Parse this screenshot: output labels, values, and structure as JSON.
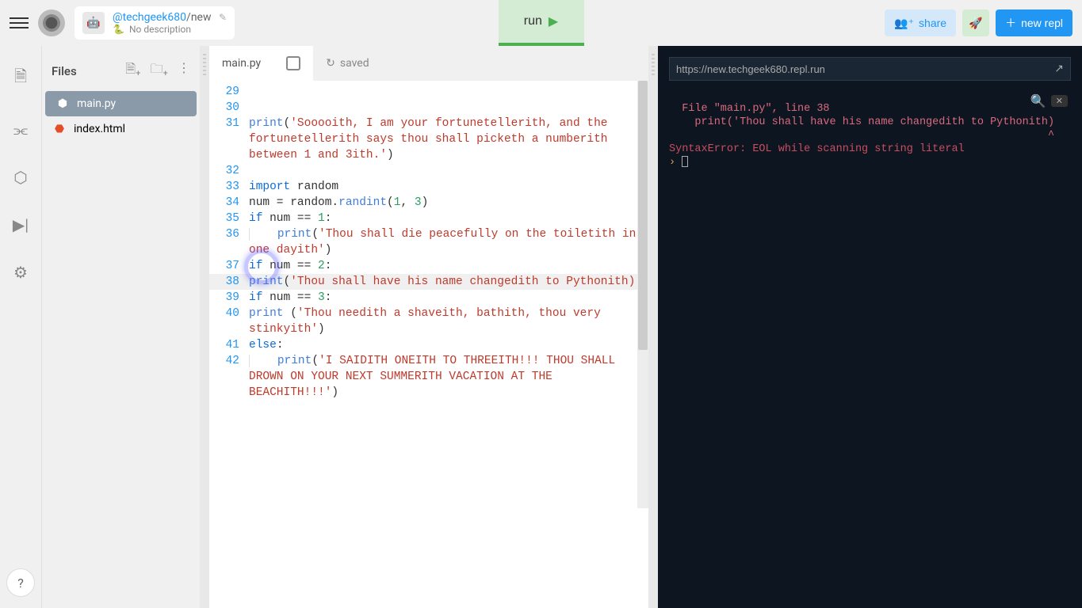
{
  "header": {
    "username": "@techgeek680",
    "separator": "/",
    "repl_name": "new",
    "description": "No description",
    "run_label": "run",
    "share_label": "share",
    "new_repl_label": "new repl"
  },
  "leftbar": {
    "icons": [
      "file",
      "share",
      "cube",
      "play-console",
      "gear"
    ]
  },
  "files": {
    "title": "Files",
    "items": [
      {
        "name": "main.py",
        "type": "python",
        "active": true
      },
      {
        "name": "index.html",
        "type": "html",
        "active": false
      }
    ]
  },
  "editor": {
    "tab_name": "main.py",
    "saved_label": "saved",
    "lines": [
      {
        "n": 29,
        "segs": []
      },
      {
        "n": 30,
        "segs": []
      },
      {
        "n": 31,
        "segs": [
          {
            "t": "print",
            "c": "fn"
          },
          {
            "t": "(",
            "c": "op"
          },
          {
            "t": "'Sooooith, I am your fortunetellerith, and the fortunetellerith says thou shall picketh a numberith between 1 and 3ith.'",
            "c": "str"
          },
          {
            "t": ")",
            "c": "op"
          }
        ]
      },
      {
        "n": 32,
        "segs": []
      },
      {
        "n": 33,
        "segs": [
          {
            "t": "import",
            "c": "kw"
          },
          {
            "t": " random",
            "c": "op"
          }
        ]
      },
      {
        "n": 34,
        "segs": [
          {
            "t": "num = random.",
            "c": "op"
          },
          {
            "t": "randint",
            "c": "fn"
          },
          {
            "t": "(",
            "c": "op"
          },
          {
            "t": "1",
            "c": "num"
          },
          {
            "t": ", ",
            "c": "op"
          },
          {
            "t": "3",
            "c": "num"
          },
          {
            "t": ")",
            "c": "op"
          }
        ]
      },
      {
        "n": 35,
        "segs": [
          {
            "t": "if",
            "c": "kw"
          },
          {
            "t": " num == ",
            "c": "op"
          },
          {
            "t": "1",
            "c": "num"
          },
          {
            "t": ":",
            "c": "op"
          }
        ]
      },
      {
        "n": 36,
        "indent": 1,
        "segs": [
          {
            "t": "print",
            "c": "fn"
          },
          {
            "t": "(",
            "c": "op"
          },
          {
            "t": "'Thou shall die peacefully on the toiletith in one dayith'",
            "c": "str"
          },
          {
            "t": ")",
            "c": "op"
          }
        ]
      },
      {
        "n": 37,
        "segs": [
          {
            "t": "if",
            "c": "kw"
          },
          {
            "t": " num == ",
            "c": "op"
          },
          {
            "t": "2",
            "c": "num"
          },
          {
            "t": ":",
            "c": "op"
          }
        ]
      },
      {
        "n": 38,
        "highlight": true,
        "segs": [
          {
            "t": "print",
            "c": "fn"
          },
          {
            "t": "(",
            "c": "op"
          },
          {
            "t": "'Thou shall have his name changedith to Pythonith)",
            "c": "str"
          }
        ]
      },
      {
        "n": 39,
        "segs": [
          {
            "t": "if",
            "c": "kw"
          },
          {
            "t": " num == ",
            "c": "op"
          },
          {
            "t": "3",
            "c": "num"
          },
          {
            "t": ":",
            "c": "op"
          }
        ]
      },
      {
        "n": 40,
        "segs": [
          {
            "t": "print ",
            "c": "fn"
          },
          {
            "t": "(",
            "c": "op"
          },
          {
            "t": "'Thou needith a shaveith, bathith, thou very stinkyith'",
            "c": "str"
          },
          {
            "t": ")",
            "c": "op"
          }
        ]
      },
      {
        "n": 41,
        "segs": [
          {
            "t": "else",
            "c": "kw"
          },
          {
            "t": ":",
            "c": "op"
          }
        ]
      },
      {
        "n": 42,
        "indent": 1,
        "segs": [
          {
            "t": "print",
            "c": "fn"
          },
          {
            "t": "(",
            "c": "op"
          },
          {
            "t": "'I SAIDITH ONEITH TO THREEITH!!! THOU SHALL DROWN ON YOUR NEXT SUMMERITH VACATION AT THE BEACHITH!!!'",
            "c": "str"
          },
          {
            "t": ")",
            "c": "op"
          }
        ]
      }
    ]
  },
  "console": {
    "url": "https://new.techgeek680.repl.run",
    "trace1": "  File \"main.py\", line 38",
    "trace2": "    print('Thou shall have his name changedith to Pythonith)",
    "caret": "                                                           ^",
    "error": "SyntaxError: EOL while scanning string literal",
    "prompt": "›"
  },
  "help": "?"
}
